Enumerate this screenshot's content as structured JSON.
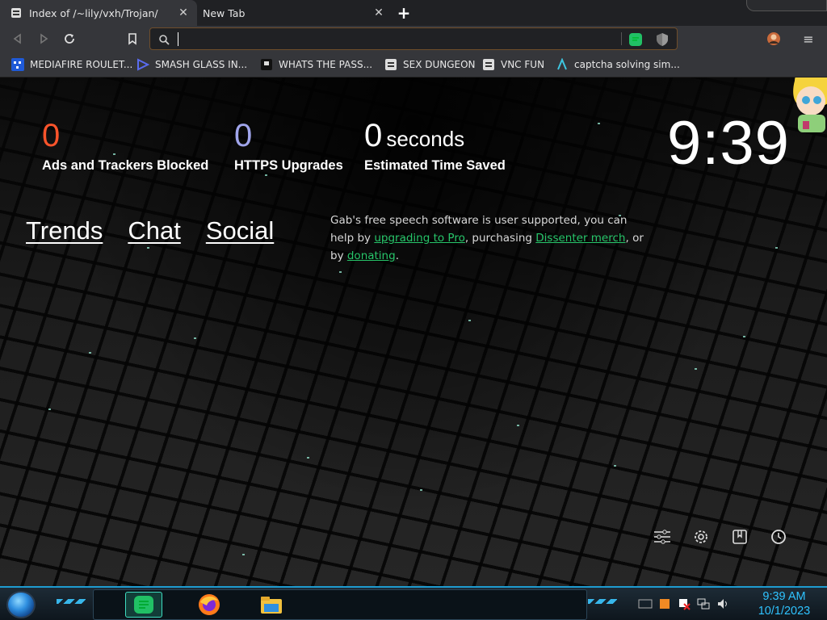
{
  "browser": {
    "tabs": [
      {
        "title": "Index of /~lily/vxh/Trojan/",
        "active": true
      },
      {
        "title": "New Tab",
        "active": false
      }
    ],
    "new_tab_symbol": "+",
    "close_symbol": "✕"
  },
  "toolbar": {
    "address_value": "",
    "menu_symbol": "≡"
  },
  "bookmarks": [
    {
      "label": "MEDIAFIRE ROULET...",
      "icon": "mf-icon"
    },
    {
      "label": "SMASH GLASS IN...",
      "icon": "smash-icon"
    },
    {
      "label": "WHATS THE PASS...",
      "icon": "page-icon"
    },
    {
      "label": "SEX DUNGEON",
      "icon": "globe-icon"
    },
    {
      "label": "VNC FUN",
      "icon": "globe-icon"
    },
    {
      "label": "captcha solving sim...",
      "icon": "a-icon"
    }
  ],
  "stats": {
    "ads_count": "0",
    "ads_label": "Ads and Trackers Blocked",
    "https_count": "0",
    "https_label": "HTTPS Upgrades",
    "time_count": "0",
    "time_unit": "seconds",
    "time_label": "Estimated Time Saved",
    "ads_color": "#fb542b",
    "https_color": "#a0a5eb"
  },
  "clock": "9:39",
  "links": [
    "Trends",
    "Chat",
    "Social"
  ],
  "gab_message": {
    "part1": "Gab's free speech software is user supported, you can help by ",
    "link1": "upgrading to Pro",
    "part2": ", purchasing ",
    "link2": "Dissenter merch",
    "part3": ", or by ",
    "link3": "donating",
    "part4": "."
  },
  "bottom_icons": [
    "customize-icon",
    "settings-icon",
    "bookmarks-icon",
    "history-icon"
  ],
  "taskbar": {
    "time": "9:39 AM",
    "date": "10/1/2023",
    "accent_color": "#1e9bd0"
  }
}
